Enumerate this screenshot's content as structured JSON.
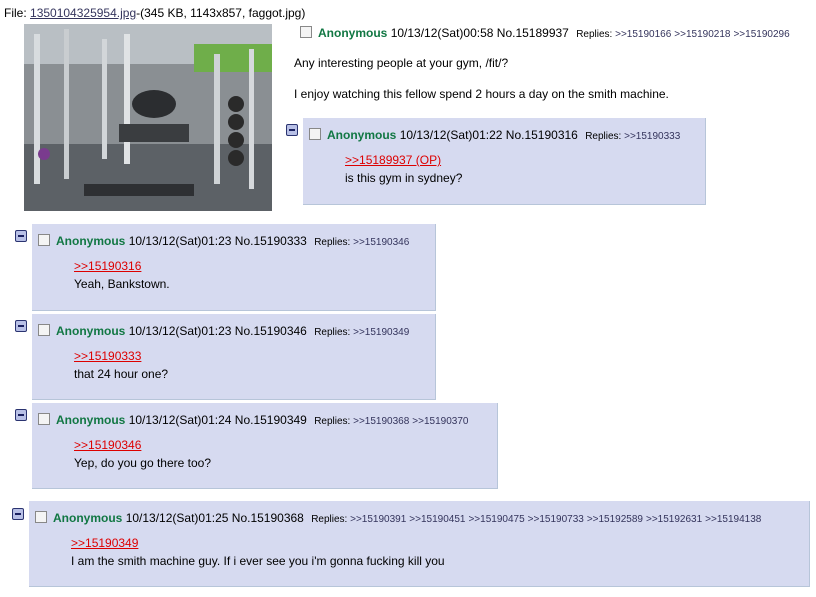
{
  "file": {
    "prefix": "File: ",
    "filename": "1350104325954.jpg",
    "meta": "-(345 KB, 1143x857, faggot.jpg)"
  },
  "op": {
    "name": "Anonymous",
    "datetime": "10/13/12(Sat)00:58",
    "number": "No.15189937",
    "replies_label": "Replies:",
    "replies": [
      ">>15190166",
      ">>15190218",
      ">>15190296"
    ],
    "lines": [
      "Any interesting people at your gym, /fit/?",
      "I enjoy watching this fellow spend 2 hours a day on the smith machine."
    ]
  },
  "posts": [
    {
      "name": "Anonymous",
      "datetime": "10/13/12(Sat)01:22",
      "number": "No.15190316",
      "replies_label": "Replies:",
      "replies": [
        ">>15190333"
      ],
      "quote": ">>15189937 (OP)",
      "text": "is this gym in sydney?"
    },
    {
      "name": "Anonymous",
      "datetime": "10/13/12(Sat)01:23",
      "number": "No.15190333",
      "replies_label": "Replies:",
      "replies": [
        ">>15190346"
      ],
      "quote": ">>15190316",
      "text": "Yeah, Bankstown."
    },
    {
      "name": "Anonymous",
      "datetime": "10/13/12(Sat)01:23",
      "number": "No.15190346",
      "replies_label": "Replies:",
      "replies": [
        ">>15190349"
      ],
      "quote": ">>15190333",
      "text": "that 24 hour one?"
    },
    {
      "name": "Anonymous",
      "datetime": "10/13/12(Sat)01:24",
      "number": "No.15190349",
      "replies_label": "Replies:",
      "replies": [
        ">>15190368",
        ">>15190370"
      ],
      "quote": ">>15190346",
      "text": "Yep, do you go there too?"
    },
    {
      "name": "Anonymous",
      "datetime": "10/13/12(Sat)01:25",
      "number": "No.15190368",
      "replies_label": "Replies:",
      "replies": [
        ">>15190391",
        ">>15190451",
        ">>15190475",
        ">>15190733",
        ">>15192589",
        ">>15192631",
        ">>15194138"
      ],
      "quote": ">>15190349",
      "text": "I am the smith machine guy. If i ever see you i'm gonna fucking kill you"
    }
  ],
  "colors": {
    "reply_bg": "#d6daf0",
    "name": "#117743",
    "quotelink": "#dd0000",
    "link": "#34345c"
  }
}
